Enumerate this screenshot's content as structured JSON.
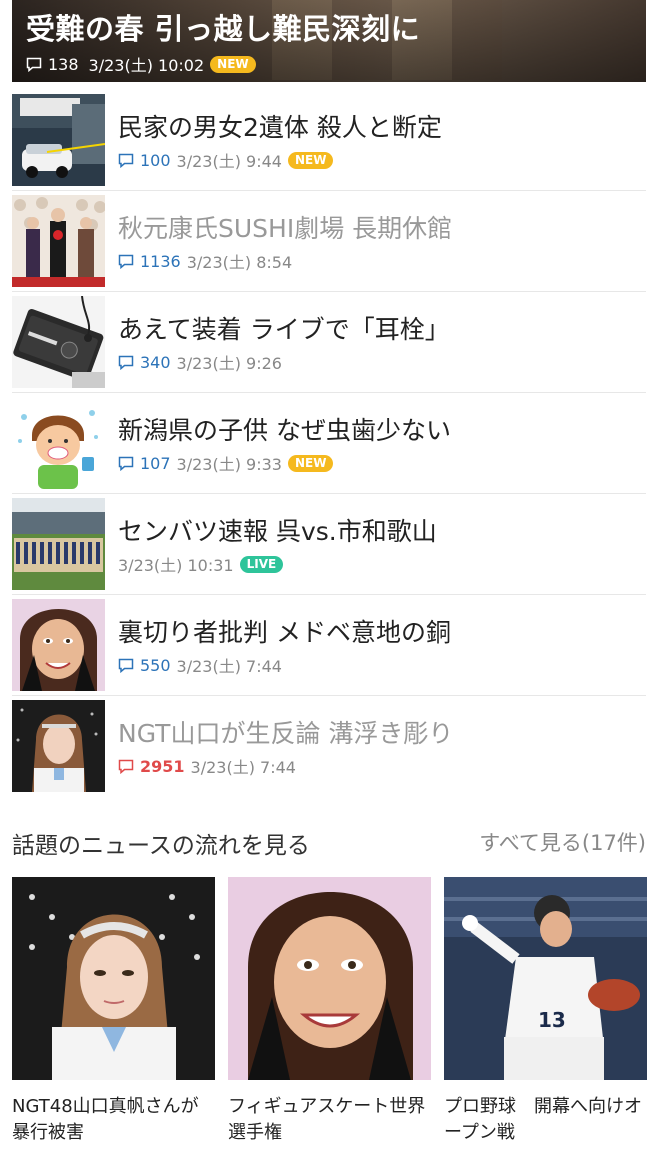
{
  "hero": {
    "title": "受難の春 引っ越し難民深刻に",
    "comments": "138",
    "date": "3/23(土) 10:02",
    "badge": "NEW"
  },
  "articles": [
    {
      "title": "民家の男女2遺体 殺人と断定",
      "comments": "100",
      "date": "3/23(土) 9:44",
      "badge": "NEW",
      "thumb": "crime-scene-police-car"
    },
    {
      "title": "秋元康氏SUSHI劇場 長期休館",
      "comments": "1136",
      "date": "3/23(土) 8:54",
      "badge": "",
      "thumb": "theater-ceremony"
    },
    {
      "title": "あえて装着 ライブで「耳栓」",
      "comments": "340",
      "date": "3/23(土) 9:26",
      "badge": "",
      "thumb": "earplug-case"
    },
    {
      "title": "新潟県の子供 なぜ虫歯少ない",
      "comments": "107",
      "date": "3/23(土) 9:33",
      "badge": "NEW",
      "thumb": "child-brushing-teeth"
    },
    {
      "title": "センバツ速報 呉vs.市和歌山",
      "comments": "",
      "date": "3/23(土) 10:31",
      "badge": "LIVE",
      "thumb": "baseball-stadium"
    },
    {
      "title": "裏切り者批判 メドベ意地の銅",
      "comments": "550",
      "date": "3/23(土) 7:44",
      "badge": "",
      "thumb": "skater-portrait"
    },
    {
      "title": "NGT山口が生反論 溝浮き彫り",
      "comments": "2951",
      "date": "3/23(土) 7:44",
      "badge": "",
      "thumb": "idol-portrait"
    }
  ],
  "topics": {
    "heading": "話題のニュースの流れを見る",
    "see_all": "すべて見る(17件)",
    "cards": [
      {
        "title": "NGT48山口真帆さんが暴行被害",
        "image": "idol-portrait"
      },
      {
        "title": "フィギュアスケート世界選手権",
        "image": "skater-portrait"
      },
      {
        "title": "プロ野球　開幕へ向けオープン戦",
        "image": "baseball-pitcher"
      }
    ]
  },
  "colors": {
    "badge_new": "#f5b91e",
    "badge_live": "#2ec49a",
    "comment_count": "#2c73b8",
    "comment_count_hot": "#e04a4a",
    "read_title": "#999999"
  }
}
